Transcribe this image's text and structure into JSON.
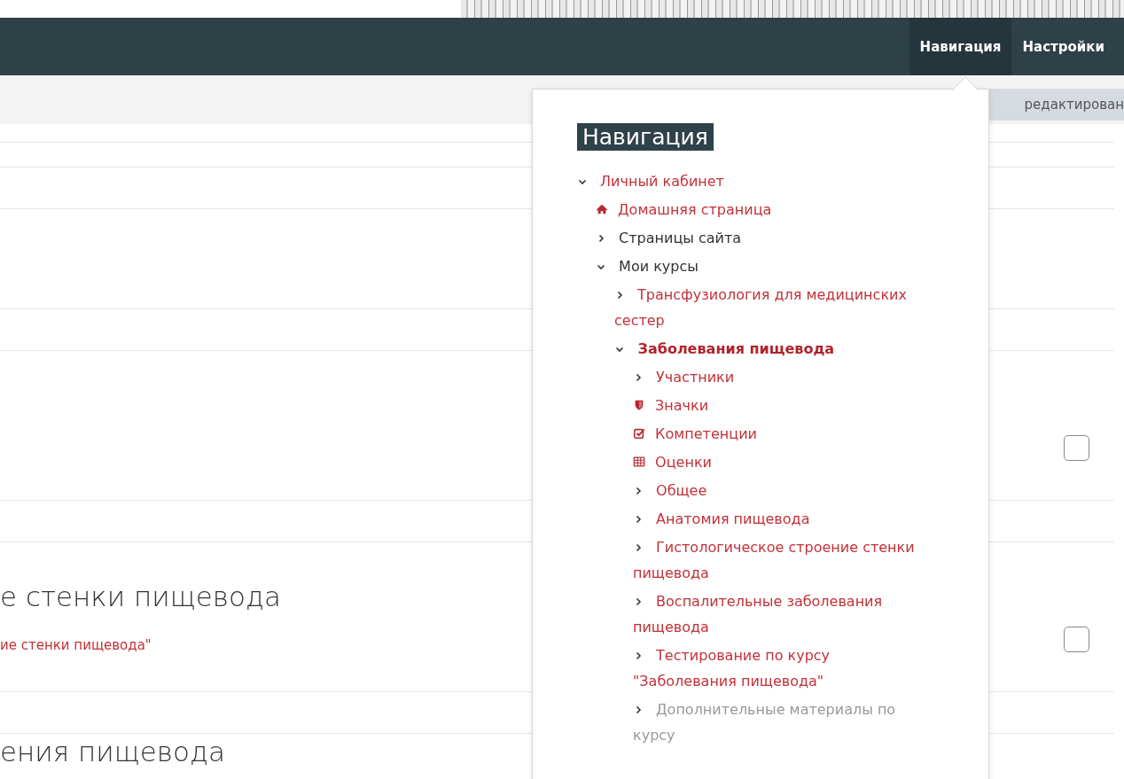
{
  "header": {
    "nav": [
      {
        "label": "Навигация",
        "selected": true
      },
      {
        "label": "Настройки",
        "selected": false
      }
    ]
  },
  "toolbar": {
    "edit_button": "редактирован"
  },
  "content": {
    "rows": [
      {
        "kind": "thin"
      },
      {
        "kind": "gap"
      },
      {
        "kind": "empty"
      },
      {
        "kind": "gap"
      },
      {
        "kind": "activity",
        "checked": false
      },
      {
        "kind": "gap"
      },
      {
        "kind": "activity",
        "title": "е стенки пищевода",
        "link": "ие стенки пищевода\"",
        "checked": false
      },
      {
        "kind": "gap"
      },
      {
        "kind": "heading",
        "title": "ения пищевода"
      }
    ]
  },
  "navigation": {
    "title": "Навигация",
    "tree": [
      {
        "label": "Личный кабинет",
        "kind": "expandable",
        "expanded": true,
        "link": true,
        "dimmed": false,
        "current": false,
        "children": [
          {
            "label": "Домашняя страница",
            "kind": "home",
            "link": true,
            "dimmed": false,
            "current": false
          },
          {
            "label": "Страницы сайта",
            "kind": "expandable",
            "expanded": false,
            "link": false,
            "dimmed": false,
            "current": false
          },
          {
            "label": "Мои курсы",
            "kind": "expandable",
            "expanded": true,
            "link": false,
            "dimmed": false,
            "current": false,
            "children": [
              {
                "label": "Трансфузиология для медицинских сестер",
                "kind": "expandable",
                "expanded": false,
                "link": true,
                "dimmed": false,
                "current": false
              },
              {
                "label": "Заболевания пищевода",
                "kind": "expandable",
                "expanded": true,
                "link": true,
                "dimmed": false,
                "current": true,
                "children": [
                  {
                    "label": "Участники",
                    "kind": "expandable",
                    "expanded": false,
                    "link": true,
                    "dimmed": false,
                    "current": false
                  },
                  {
                    "label": "Значки",
                    "kind": "badges",
                    "link": true,
                    "dimmed": false,
                    "current": false
                  },
                  {
                    "label": "Компетенции",
                    "kind": "competencies",
                    "link": true,
                    "dimmed": false,
                    "current": false
                  },
                  {
                    "label": "Оценки",
                    "kind": "grades",
                    "link": true,
                    "dimmed": false,
                    "current": false
                  },
                  {
                    "label": "Общее",
                    "kind": "expandable",
                    "expanded": false,
                    "link": true,
                    "dimmed": false,
                    "current": false
                  },
                  {
                    "label": "Анатомия пищевода",
                    "kind": "expandable",
                    "expanded": false,
                    "link": true,
                    "dimmed": false,
                    "current": false
                  },
                  {
                    "label": "Гистологическое строение стенки пищевода",
                    "kind": "expandable",
                    "expanded": false,
                    "link": true,
                    "dimmed": false,
                    "current": false
                  },
                  {
                    "label": "Воспалительные заболевания пищевода",
                    "kind": "expandable",
                    "expanded": false,
                    "link": true,
                    "dimmed": false,
                    "current": false
                  },
                  {
                    "label": "Тестирование по курсу \"Заболевания пищевода\"",
                    "kind": "expandable",
                    "expanded": false,
                    "link": true,
                    "dimmed": false,
                    "current": false
                  },
                  {
                    "label": "Дополнительные материалы по курсу",
                    "kind": "expandable",
                    "expanded": false,
                    "link": true,
                    "dimmed": true,
                    "current": false
                  }
                ]
              }
            ]
          }
        ]
      }
    ]
  }
}
